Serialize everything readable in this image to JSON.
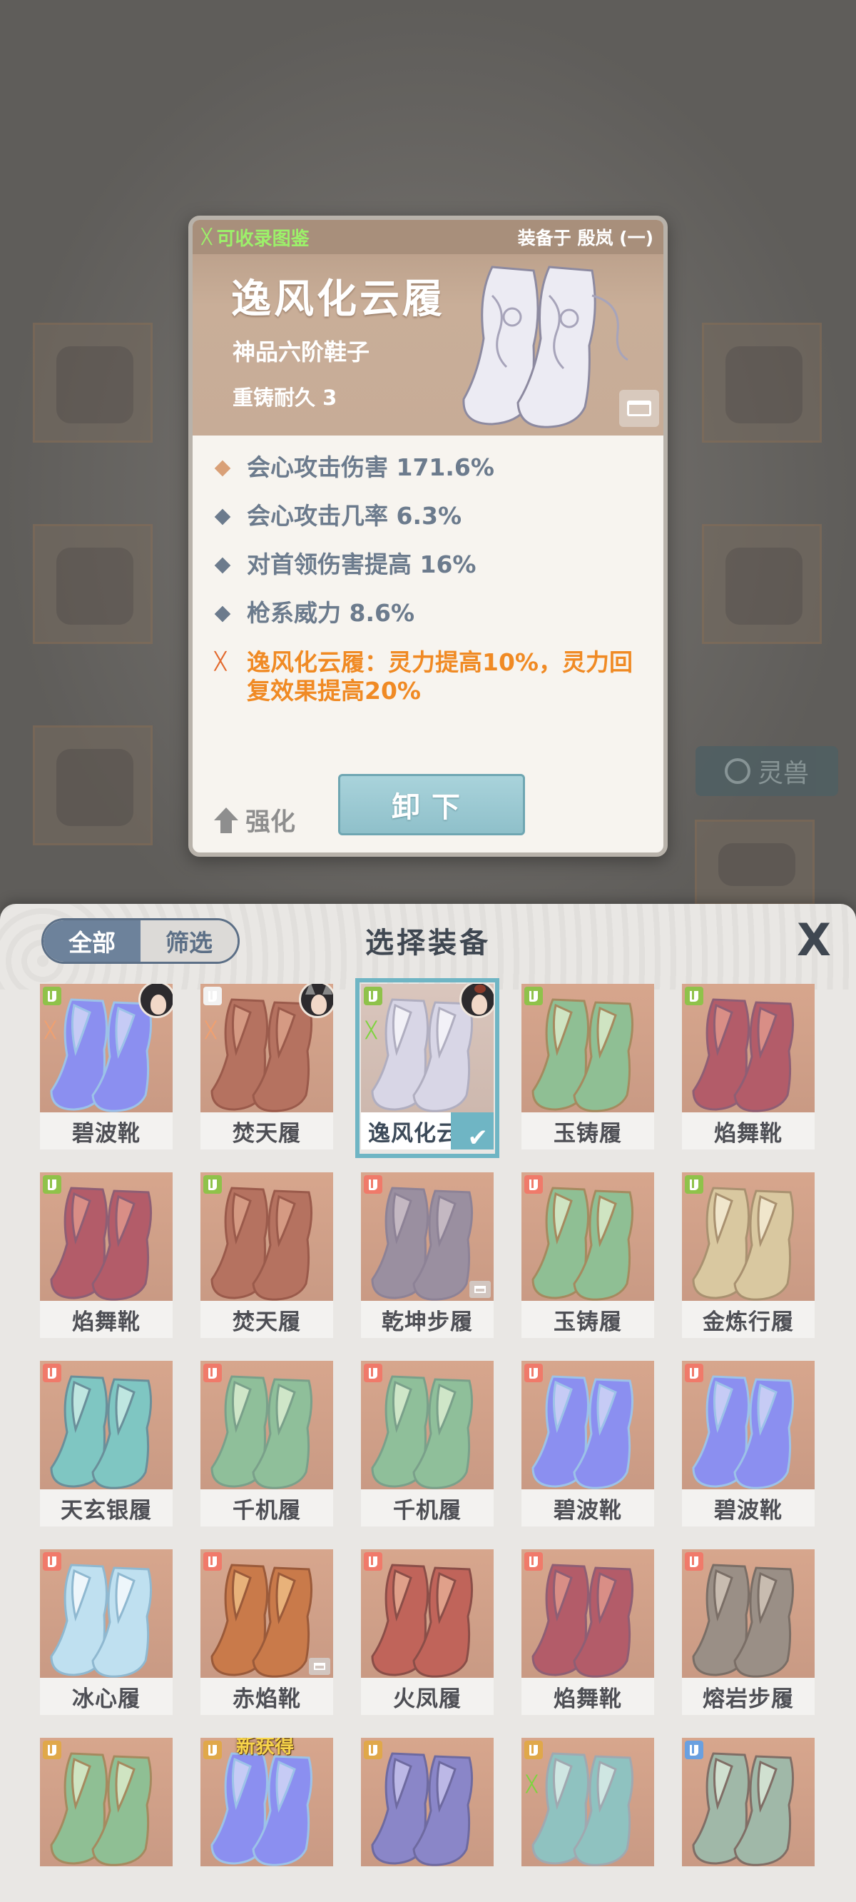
{
  "detail": {
    "collect_label": "可收录图鉴",
    "equipped_by": "装备于 殷岚 (一)",
    "name": "逸风化云履",
    "grade": "神品六阶鞋子",
    "durability": "重铸耐久 3",
    "stats": [
      {
        "text": "会心攻击伤害 171.6%",
        "color": "#d9a077"
      },
      {
        "text": "会心攻击几率 6.3%",
        "color": "#6c7b8d"
      },
      {
        "text": "对首领伤害提高 16%",
        "color": "#6c7b8d"
      },
      {
        "text": "枪系威力 8.6%",
        "color": "#6c7b8d"
      }
    ],
    "set_effect": "逸风化云履：灵力提高10%，灵力回复效果提高20%",
    "strengthen_label": "强化",
    "unequip_label": "卸下"
  },
  "background": {
    "spirit_beast_label": "灵兽"
  },
  "panel": {
    "tab_all": "全部",
    "tab_filter": "筛选",
    "title": "选择装备",
    "close_glyph": "X",
    "check_glyph": "✔",
    "new_tag": "新获得",
    "items": [
      {
        "name": "碧波靴",
        "slot_color": "#8fc24a",
        "palette": [
          "#8b8ff0",
          "#c6cbf5",
          "#9cc2e8"
        ],
        "set": true,
        "set_color": "orange",
        "owner": "a"
      },
      {
        "name": "焚天履",
        "slot_color": "#f2f2f2",
        "palette": [
          "#b57260",
          "#d59a83",
          "#9a5a4b"
        ],
        "set": true,
        "set_color": "orange",
        "owner": "b"
      },
      {
        "name": "逸风化云履",
        "slot_color": "#8fc24a",
        "palette": [
          "#d8d6e6",
          "#f2f1f7",
          "#b0aec0"
        ],
        "set": true,
        "set_color": "green",
        "owner": "c",
        "selected": true
      },
      {
        "name": "玉铸履",
        "slot_color": "#8fc24a",
        "palette": [
          "#8fbf94",
          "#cfe4c2",
          "#a58a5f"
        ]
      },
      {
        "name": "焰舞靴",
        "slot_color": "#8fc24a",
        "palette": [
          "#b35c69",
          "#d98e86",
          "#8e5e74"
        ]
      },
      {
        "name": "焰舞靴",
        "slot_color": "#8fc24a",
        "palette": [
          "#b35c69",
          "#d98e86",
          "#8e5e74"
        ]
      },
      {
        "name": "焚天履",
        "slot_color": "#8fc24a",
        "palette": [
          "#b57260",
          "#d59a83",
          "#9a5a4b"
        ]
      },
      {
        "name": "乾坤步履",
        "slot_color": "#f07a6a",
        "palette": [
          "#9a8fa0",
          "#c4b8c2",
          "#8d8296"
        ],
        "reforge": true
      },
      {
        "name": "玉铸履",
        "slot_color": "#f07a6a",
        "palette": [
          "#8fbf94",
          "#cfe4c2",
          "#a58a5f"
        ]
      },
      {
        "name": "金炼行履",
        "slot_color": "#8fc24a",
        "palette": [
          "#d9c8a0",
          "#f0e6cc",
          "#a99170"
        ]
      },
      {
        "name": "天玄银履",
        "slot_color": "#f07a6a",
        "palette": [
          "#7fc6c2",
          "#bfe6e0",
          "#6a8f9a"
        ]
      },
      {
        "name": "千机履",
        "slot_color": "#f07a6a",
        "palette": [
          "#8fbf9a",
          "#cfe6c8",
          "#7aa08a"
        ]
      },
      {
        "name": "千机履",
        "slot_color": "#f07a6a",
        "palette": [
          "#8fbf9a",
          "#cfe6c8",
          "#7aa08a"
        ]
      },
      {
        "name": "碧波靴",
        "slot_color": "#f07a6a",
        "palette": [
          "#8b8ff0",
          "#c6cbf5",
          "#9cc2e8"
        ]
      },
      {
        "name": "碧波靴",
        "slot_color": "#f07a6a",
        "palette": [
          "#8b8ff0",
          "#c6cbf5",
          "#9cc2e8"
        ]
      },
      {
        "name": "冰心履",
        "slot_color": "#f07a6a",
        "palette": [
          "#bfe0f0",
          "#eef6fb",
          "#8fb8d0"
        ]
      },
      {
        "name": "赤焰靴",
        "slot_color": "#f07a6a",
        "palette": [
          "#c97a4a",
          "#e8b27a",
          "#9a5a3a"
        ],
        "reforge": true
      },
      {
        "name": "火凤履",
        "slot_color": "#f07a6a",
        "palette": [
          "#c0645a",
          "#e0a08a",
          "#8a4e48"
        ]
      },
      {
        "name": "焰舞靴",
        "slot_color": "#f07a6a",
        "palette": [
          "#b35c69",
          "#d98e86",
          "#8e5e74"
        ]
      },
      {
        "name": "熔岩步履",
        "slot_color": "#f07a6a",
        "palette": [
          "#9a8f86",
          "#c8bcb0",
          "#7a6e66"
        ]
      },
      {
        "name": "",
        "slot_color": "#e0a84a",
        "palette": [
          "#8fbf94",
          "#cfe4c2",
          "#a58a5f"
        ]
      },
      {
        "name": "",
        "slot_color": "#e0a84a",
        "palette": [
          "#8b8ff0",
          "#c6cbf5",
          "#9cc2e8"
        ],
        "new": true
      },
      {
        "name": "",
        "slot_color": "#e0a84a",
        "palette": [
          "#8a86c8",
          "#bcb8e6",
          "#6e6aa0"
        ]
      },
      {
        "name": "",
        "slot_color": "#e0a84a",
        "palette": [
          "#8fc2c0",
          "#cfe6e2",
          "#a0a8b0"
        ],
        "set": true,
        "set_color": "green"
      },
      {
        "name": "",
        "slot_color": "#6aa0e0",
        "palette": [
          "#a0b8a8",
          "#d0e0d0",
          "#806e66"
        ]
      }
    ]
  }
}
